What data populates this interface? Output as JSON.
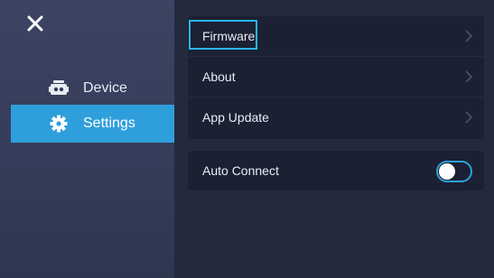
{
  "sidebar": {
    "close_icon": "close-icon",
    "items": [
      {
        "label": "Device",
        "icon": "robot-icon",
        "active": false
      },
      {
        "label": "Settings",
        "icon": "gear-icon",
        "active": true
      }
    ]
  },
  "settings": {
    "group1": [
      {
        "label": "Firmware",
        "icon": "chevron-right-icon",
        "focused": true
      },
      {
        "label": "About",
        "icon": "chevron-right-icon"
      },
      {
        "label": "App Update",
        "icon": "chevron-right-icon"
      }
    ],
    "group2": [
      {
        "label": "Auto Connect",
        "toggle_state": "off"
      }
    ]
  },
  "colors": {
    "accent": "#2f9fdc",
    "focus_outline": "#2bb5ee",
    "sidebar_bg": "#3c4463",
    "main_bg": "#242a3d",
    "card_bg": "#1b2133"
  }
}
